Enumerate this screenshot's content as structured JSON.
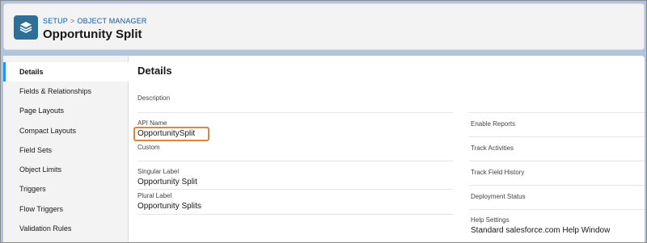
{
  "header": {
    "breadcrumb": [
      "SETUP",
      "OBJECT MANAGER"
    ],
    "breadcrumb_separator": ">",
    "title": "Opportunity Split",
    "icon": "stack-layers-icon"
  },
  "sidebar": {
    "items": [
      {
        "label": "Details",
        "active": true
      },
      {
        "label": "Fields & Relationships",
        "active": false
      },
      {
        "label": "Page Layouts",
        "active": false
      },
      {
        "label": "Compact Layouts",
        "active": false
      },
      {
        "label": "Field Sets",
        "active": false
      },
      {
        "label": "Object Limits",
        "active": false
      },
      {
        "label": "Triggers",
        "active": false
      },
      {
        "label": "Flow Triggers",
        "active": false
      },
      {
        "label": "Validation Rules",
        "active": false
      }
    ]
  },
  "details": {
    "title": "Details",
    "left_fields": [
      {
        "label": "Description",
        "value": ""
      },
      {
        "label": "API Name",
        "value": "OpportunitySplit"
      },
      {
        "label": "Custom",
        "value": ""
      },
      {
        "label": "Singular Label",
        "value": "Opportunity Split"
      },
      {
        "label": "Plural Label",
        "value": "Opportunity Splits"
      }
    ],
    "right_fields": [
      {
        "label": "Enable Reports",
        "value": ""
      },
      {
        "label": "Track Activities",
        "value": ""
      },
      {
        "label": "Track Field History",
        "value": ""
      },
      {
        "label": "Deployment Status",
        "value": ""
      },
      {
        "label": "Help Settings",
        "value": "Standard salesforce.com Help Window"
      }
    ]
  },
  "colors": {
    "accent": "#1b96ff",
    "highlight": "#d9863f",
    "icon_bg": "#2e6f97"
  }
}
